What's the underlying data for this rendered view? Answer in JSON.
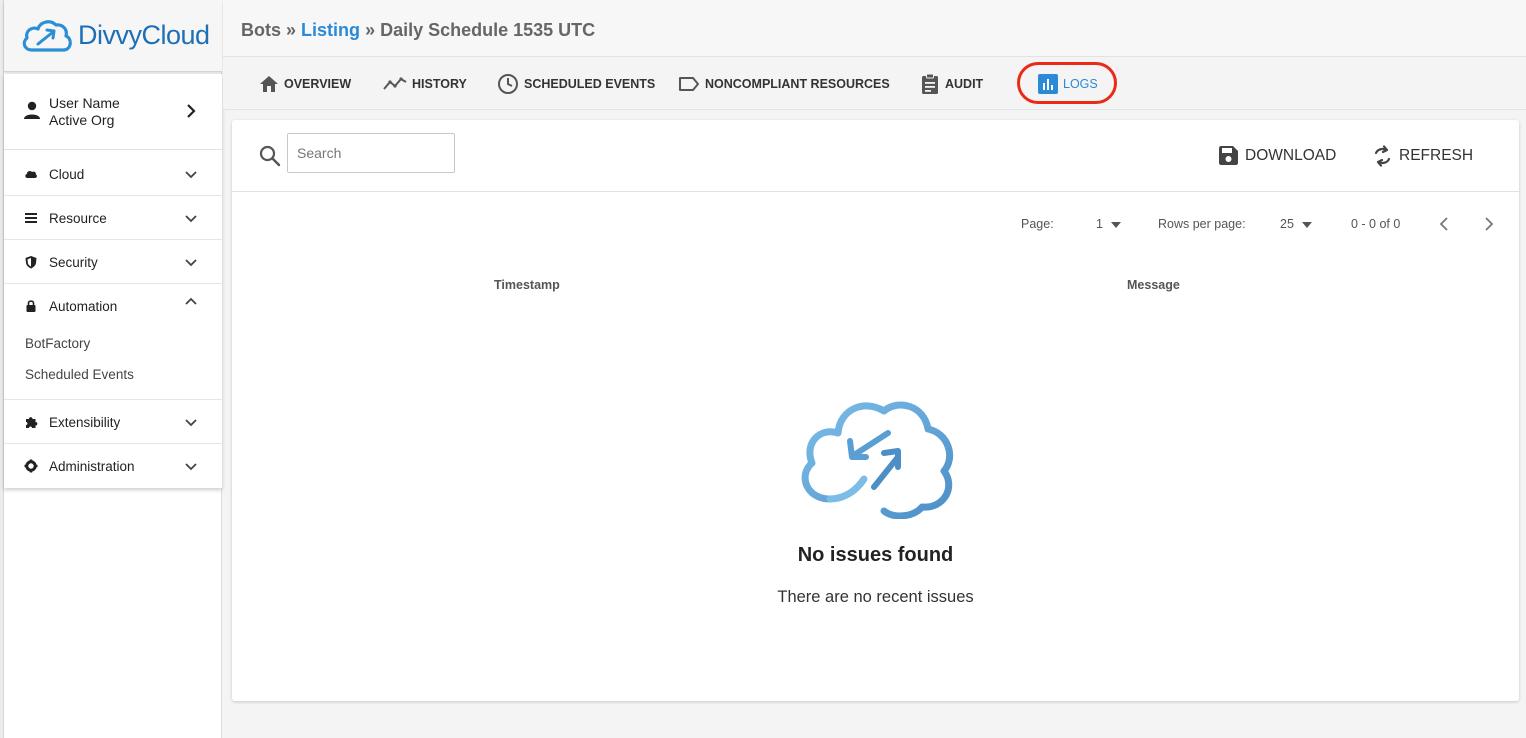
{
  "brand": {
    "name": "DivvyCloud",
    "color": "#1f6fb5"
  },
  "user": {
    "name": "User Name",
    "org": "Active Org"
  },
  "nav": {
    "cloud": "Cloud",
    "resource": "Resource",
    "security": "Security",
    "automation": "Automation",
    "automation_items": [
      "BotFactory",
      "Scheduled Events"
    ],
    "extensibility": "Extensibility",
    "administration": "Administration"
  },
  "breadcrumb": {
    "root": "Bots",
    "sep": "»",
    "link": "Listing",
    "current": "Daily Schedule 1535 UTC"
  },
  "tabs": {
    "overview": "OVERVIEW",
    "history": "HISTORY",
    "scheduled_events": "SCHEDULED EVENTS",
    "noncompliant": "NONCOMPLIANT RESOURCES",
    "audit": "AUDIT",
    "logs": "LOGS",
    "active": "logs"
  },
  "search": {
    "placeholder": "Search"
  },
  "actions": {
    "download": "DOWNLOAD",
    "refresh": "REFRESH"
  },
  "pagination": {
    "page_label": "Page:",
    "page_value": "1",
    "rows_label": "Rows per page:",
    "rows_value": "25",
    "range": "0 - 0 of 0"
  },
  "table": {
    "columns": [
      "Timestamp",
      "Message"
    ]
  },
  "empty": {
    "title": "No issues found",
    "subtitle": "There are no recent issues"
  },
  "colors": {
    "accent": "#2a8ad8",
    "highlight_ring": "#ea2a17"
  }
}
